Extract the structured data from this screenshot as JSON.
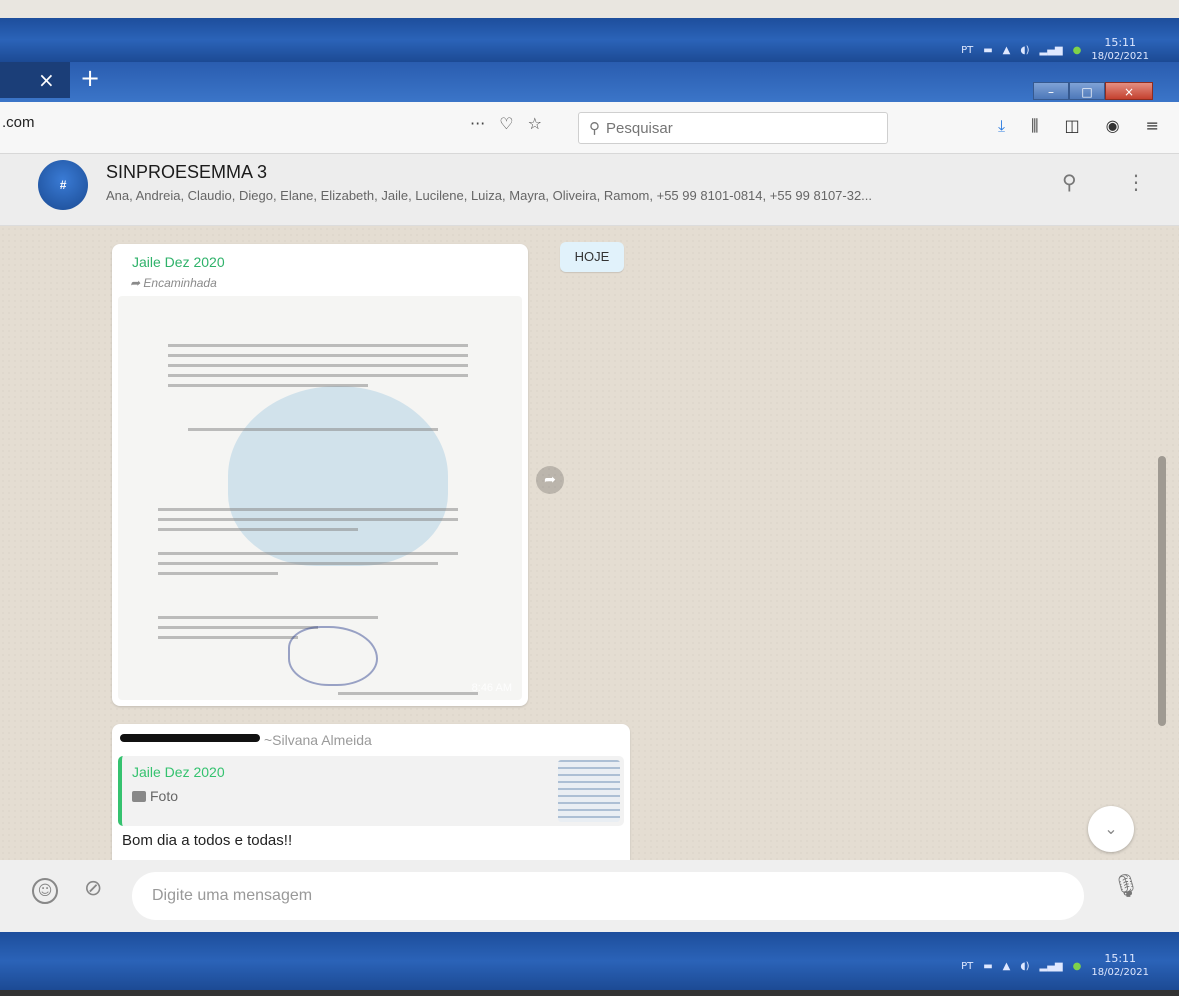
{
  "taskbar": {
    "language": "PT",
    "time": "15:11",
    "date": "18/02/2021"
  },
  "browser": {
    "url_fragment": ".com",
    "page_actions": [
      "···",
      "♡",
      "☆"
    ],
    "search_placeholder": "Pesquisar",
    "toolbar_icons": [
      "download-icon",
      "library-icon",
      "sidebar-icon",
      "account-icon",
      "menu-icon"
    ]
  },
  "chat": {
    "group_name": "SINPROESEMMA 3",
    "members": "Ana, Andreia, Claudio, Diego, Elane, Elizabeth, Jaile, Lucilene, Luiza, Mayra, Oliveira, Ramom, +55 99 8101-0814, +55 99 8107-32...",
    "day_label": "HOJE",
    "messages": [
      {
        "sender": "Jaile Dez 2020",
        "forwarded_label": "Encaminhada",
        "time": "8:46 AM"
      },
      {
        "sender": "~Silvana Almeida",
        "quoted_sender": "Jaile Dez 2020",
        "quoted_type": "Foto",
        "text": "Bom dia a todos e todas!!"
      }
    ],
    "compose_placeholder": "Digite uma mensagem"
  },
  "colors": {
    "accent_green": "#35c26f",
    "taskbar_blue": "#2b63b8",
    "chat_bg": "#e4ddd2"
  }
}
